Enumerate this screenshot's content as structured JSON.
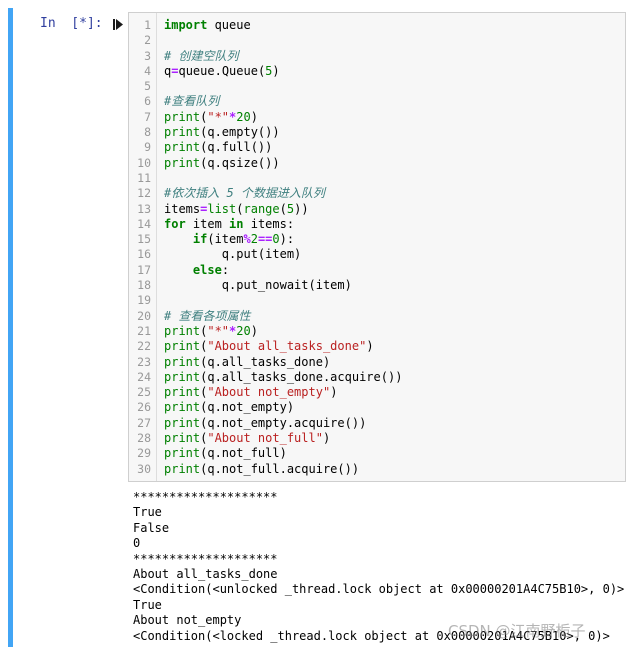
{
  "cell": {
    "prompt": "In  [*]:",
    "run_icon": "step-run-icon",
    "accent_color": "#42a5f5"
  },
  "code_lines": [
    {
      "n": "1",
      "tokens": [
        {
          "t": "import",
          "c": "kw"
        },
        {
          "t": " queue",
          "c": ""
        }
      ]
    },
    {
      "n": "2",
      "tokens": []
    },
    {
      "n": "3",
      "tokens": [
        {
          "t": "# 创建空队列",
          "c": "cm"
        }
      ]
    },
    {
      "n": "4",
      "tokens": [
        {
          "t": "q",
          "c": ""
        },
        {
          "t": "=",
          "c": "op"
        },
        {
          "t": "queue.Queue(",
          "c": ""
        },
        {
          "t": "5",
          "c": "nm"
        },
        {
          "t": ")",
          "c": ""
        }
      ]
    },
    {
      "n": "5",
      "tokens": []
    },
    {
      "n": "6",
      "tokens": [
        {
          "t": "#查看队列",
          "c": "cm"
        }
      ]
    },
    {
      "n": "7",
      "tokens": [
        {
          "t": "print",
          "c": "bi"
        },
        {
          "t": "(",
          "c": ""
        },
        {
          "t": "\"*\"",
          "c": "st"
        },
        {
          "t": "*",
          "c": "op"
        },
        {
          "t": "20",
          "c": "nm"
        },
        {
          "t": ")",
          "c": ""
        }
      ]
    },
    {
      "n": "8",
      "tokens": [
        {
          "t": "print",
          "c": "bi"
        },
        {
          "t": "(q.empty())",
          "c": ""
        }
      ]
    },
    {
      "n": "9",
      "tokens": [
        {
          "t": "print",
          "c": "bi"
        },
        {
          "t": "(q.full())",
          "c": ""
        }
      ]
    },
    {
      "n": "10",
      "tokens": [
        {
          "t": "print",
          "c": "bi"
        },
        {
          "t": "(q.qsize())",
          "c": ""
        }
      ]
    },
    {
      "n": "11",
      "tokens": []
    },
    {
      "n": "12",
      "tokens": [
        {
          "t": "#依次插入 5 个数据进入队列",
          "c": "cm"
        }
      ]
    },
    {
      "n": "13",
      "tokens": [
        {
          "t": "items",
          "c": ""
        },
        {
          "t": "=",
          "c": "op"
        },
        {
          "t": "list",
          "c": "bi"
        },
        {
          "t": "(",
          "c": ""
        },
        {
          "t": "range",
          "c": "bi"
        },
        {
          "t": "(",
          "c": ""
        },
        {
          "t": "5",
          "c": "nm"
        },
        {
          "t": "))",
          "c": ""
        }
      ]
    },
    {
      "n": "14",
      "tokens": [
        {
          "t": "for",
          "c": "kw"
        },
        {
          "t": " item ",
          "c": ""
        },
        {
          "t": "in",
          "c": "kw"
        },
        {
          "t": " items:",
          "c": ""
        }
      ]
    },
    {
      "n": "15",
      "tokens": [
        {
          "t": "    ",
          "c": ""
        },
        {
          "t": "if",
          "c": "kw"
        },
        {
          "t": "(item",
          "c": ""
        },
        {
          "t": "%",
          "c": "op"
        },
        {
          "t": "2",
          "c": "nm"
        },
        {
          "t": "==",
          "c": "op"
        },
        {
          "t": "0",
          "c": "nm"
        },
        {
          "t": "):",
          "c": ""
        }
      ]
    },
    {
      "n": "16",
      "tokens": [
        {
          "t": "        q.put(item)",
          "c": ""
        }
      ]
    },
    {
      "n": "17",
      "tokens": [
        {
          "t": "    ",
          "c": ""
        },
        {
          "t": "else",
          "c": "kw"
        },
        {
          "t": ":",
          "c": ""
        }
      ]
    },
    {
      "n": "18",
      "tokens": [
        {
          "t": "        q.put_nowait(item)",
          "c": ""
        }
      ]
    },
    {
      "n": "19",
      "tokens": []
    },
    {
      "n": "20",
      "tokens": [
        {
          "t": "# 查看各项属性",
          "c": "cm"
        }
      ]
    },
    {
      "n": "21",
      "tokens": [
        {
          "t": "print",
          "c": "bi"
        },
        {
          "t": "(",
          "c": ""
        },
        {
          "t": "\"*\"",
          "c": "st"
        },
        {
          "t": "*",
          "c": "op"
        },
        {
          "t": "20",
          "c": "nm"
        },
        {
          "t": ")",
          "c": ""
        }
      ]
    },
    {
      "n": "22",
      "tokens": [
        {
          "t": "print",
          "c": "bi"
        },
        {
          "t": "(",
          "c": ""
        },
        {
          "t": "\"About all_tasks_done\"",
          "c": "st"
        },
        {
          "t": ")",
          "c": ""
        }
      ]
    },
    {
      "n": "23",
      "tokens": [
        {
          "t": "print",
          "c": "bi"
        },
        {
          "t": "(q.all_tasks_done)",
          "c": ""
        }
      ]
    },
    {
      "n": "24",
      "tokens": [
        {
          "t": "print",
          "c": "bi"
        },
        {
          "t": "(q.all_tasks_done.acquire())",
          "c": ""
        }
      ]
    },
    {
      "n": "25",
      "tokens": [
        {
          "t": "print",
          "c": "bi"
        },
        {
          "t": "(",
          "c": ""
        },
        {
          "t": "\"About not_empty\"",
          "c": "st"
        },
        {
          "t": ")",
          "c": ""
        }
      ]
    },
    {
      "n": "26",
      "tokens": [
        {
          "t": "print",
          "c": "bi"
        },
        {
          "t": "(q.not_empty)",
          "c": ""
        }
      ]
    },
    {
      "n": "27",
      "tokens": [
        {
          "t": "print",
          "c": "bi"
        },
        {
          "t": "(q.not_empty.acquire())",
          "c": ""
        }
      ]
    },
    {
      "n": "28",
      "tokens": [
        {
          "t": "print",
          "c": "bi"
        },
        {
          "t": "(",
          "c": ""
        },
        {
          "t": "\"About not_full\"",
          "c": "st"
        },
        {
          "t": ")",
          "c": ""
        }
      ]
    },
    {
      "n": "29",
      "tokens": [
        {
          "t": "print",
          "c": "bi"
        },
        {
          "t": "(q.not_full)",
          "c": ""
        }
      ]
    },
    {
      "n": "30",
      "tokens": [
        {
          "t": "print",
          "c": "bi"
        },
        {
          "t": "(q.not_full.acquire())",
          "c": ""
        }
      ]
    }
  ],
  "output_lines": [
    "********************",
    "True",
    "False",
    "0",
    "********************",
    "About all_tasks_done",
    "<Condition(<unlocked _thread.lock object at 0x00000201A4C75B10>, 0)>",
    "True",
    "About not_empty",
    "<Condition(<locked _thread.lock object at 0x00000201A4C75B10>, 0)>"
  ],
  "watermark": "CSDN @江南野栀子"
}
